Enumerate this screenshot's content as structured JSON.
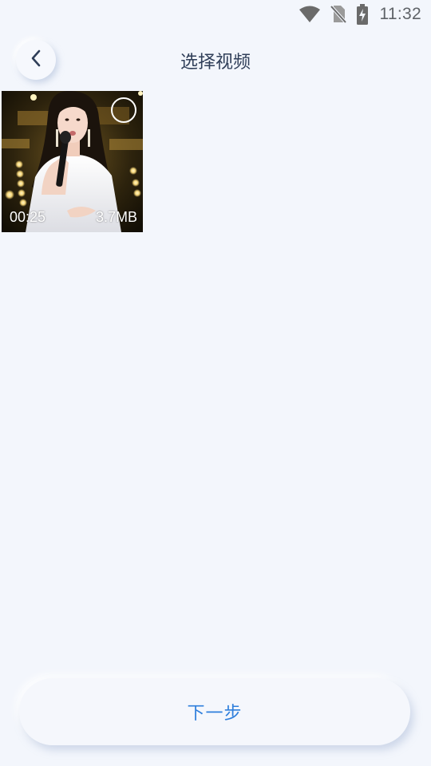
{
  "status_bar": {
    "time": "11:32",
    "icons": [
      "wifi-icon",
      "no-sim-icon",
      "battery-charging-icon"
    ]
  },
  "header": {
    "back_icon": "chevron-left-icon",
    "title": "选择视频"
  },
  "videos": [
    {
      "duration": "00:25",
      "size": "3.7MB",
      "selected": false
    }
  ],
  "footer": {
    "next_label": "下一步"
  },
  "colors": {
    "background": "#f3f6fc",
    "title": "#2f3e58",
    "accent": "#2f7fdc"
  }
}
